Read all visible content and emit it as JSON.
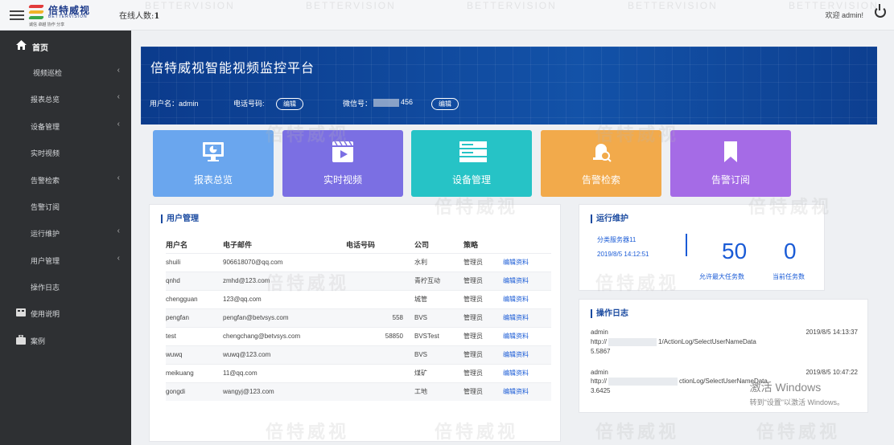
{
  "header": {
    "logo_cn": "倍特威视",
    "logo_en": "BETTERVISION",
    "logo_slogan": "诚信 卓越 协作 分享",
    "online_label": "在线人数:",
    "online_count": "1",
    "welcome": "欢迎 admin!"
  },
  "sidebar": {
    "items": [
      {
        "label": "首页",
        "icon": "home-icon",
        "chevron": ""
      },
      {
        "label": "视频巡检",
        "icon": "",
        "chevron": "‹"
      },
      {
        "label": "报表总览",
        "icon": "",
        "chevron": "‹"
      },
      {
        "label": "设备管理",
        "icon": "",
        "chevron": "‹"
      },
      {
        "label": "实时视频",
        "icon": "",
        "chevron": ""
      },
      {
        "label": "告警检索",
        "icon": "",
        "chevron": "‹"
      },
      {
        "label": "告警订阅",
        "icon": "",
        "chevron": ""
      },
      {
        "label": "运行维护",
        "icon": "",
        "chevron": "‹"
      },
      {
        "label": "用户管理",
        "icon": "",
        "chevron": "‹"
      },
      {
        "label": "操作日志",
        "icon": "",
        "chevron": ""
      },
      {
        "label": "使用说明",
        "icon": "book-icon",
        "chevron": ""
      },
      {
        "label": "案例",
        "icon": "case-icon",
        "chevron": ""
      }
    ]
  },
  "banner": {
    "title": "倍特威视智能视频监控平台",
    "username_label": "用户名：admin",
    "phone_label": "电话号码:",
    "phone_edit": "编辑",
    "wechat_label": "微信号：",
    "wechat_suffix": "456",
    "wechat_edit": "编辑"
  },
  "tiles": [
    {
      "label": "报表总览",
      "color": "#6aa6ee",
      "icon": "chart-monitor-icon"
    },
    {
      "label": "实时视频",
      "color": "#7b6fe3",
      "icon": "video-icon"
    },
    {
      "label": "设备管理",
      "color": "#26c3c6",
      "icon": "server-icon"
    },
    {
      "label": "告警检索",
      "color": "#f2aa4b",
      "icon": "alarm-search-icon"
    },
    {
      "label": "告警订阅",
      "color": "#a56be6",
      "icon": "bookmark-icon"
    }
  ],
  "users": {
    "title": "用户管理",
    "columns": [
      "用户名",
      "电子邮件",
      "电话号码",
      "公司",
      "策略",
      ""
    ],
    "rows": [
      [
        "shuili",
        "906618070@qq.com",
        "",
        "水利",
        "管理员",
        "编辑资料"
      ],
      [
        "qnhd",
        "zmhd@123.com",
        "",
        "青柠互动",
        "管理员",
        "编辑资料"
      ],
      [
        "chengguan",
        "123@qq.com",
        "",
        "城管",
        "管理员",
        "编辑资料"
      ],
      [
        "pengfan",
        "pengfan@betvsys.com",
        "558",
        "BVS",
        "管理员",
        "编辑资料"
      ],
      [
        "test",
        "chengchang@betvsys.com",
        "58850",
        "BVSTest",
        "管理员",
        "编辑资料"
      ],
      [
        "wuwq",
        "wuwq@123.com",
        "",
        "BVS",
        "管理员",
        "编辑资料"
      ],
      [
        "meikuang",
        "11@qq.com",
        "",
        "煤矿",
        "管理员",
        "编辑资料"
      ],
      [
        "gongdi",
        "wangyj@123.com",
        "",
        "工地",
        "管理员",
        "编辑资料"
      ]
    ]
  },
  "maintenance": {
    "title": "运行维护",
    "server": "分类服务器11",
    "datetime": "2019/8/5 14:12:51",
    "max_tasks": "50",
    "max_tasks_label": "允许最大任务数",
    "current_tasks": "0",
    "current_tasks_label": "当前任务数"
  },
  "oplog": {
    "title": "操作日志",
    "entries": [
      {
        "user": "admin",
        "time": "2019/8/5 14:13:37",
        "url_prefix": "http://",
        "url_suffix": "1/ActionLog/SelectUserNameData",
        "value": "5.5867"
      },
      {
        "user": "admin",
        "time": "2019/8/5 10:47:22",
        "url_prefix": "http://",
        "url_suffix": "ctionLog/SelectUserNameData",
        "value": "3.6425"
      }
    ]
  },
  "windows_activation": {
    "line1": "激活 Windows",
    "line2": "转到\"设置\"以激活 Windows。"
  },
  "watermark": {
    "cn": "倍特威视",
    "en": "BETTERVISION",
    "slogan": "诚信 卓越 协作 分享"
  }
}
